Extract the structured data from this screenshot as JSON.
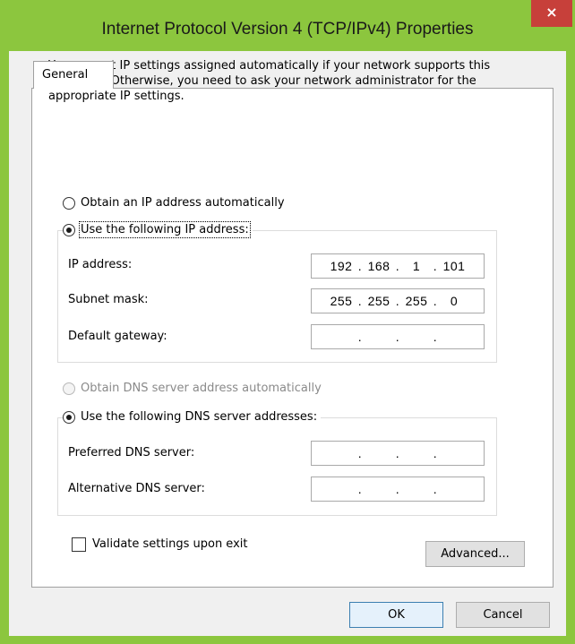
{
  "window": {
    "title": "Internet Protocol Version 4 (TCP/IPv4) Properties",
    "close_label": "×"
  },
  "tabs": [
    {
      "label": "General"
    }
  ],
  "general": {
    "description": "You can get IP settings assigned automatically if your network supports this capability. Otherwise, you need to ask your network administrator for the appropriate IP settings.",
    "ip_auto_label": "Obtain an IP address automatically",
    "ip_manual_label": "Use the following IP address:",
    "ip_mode": "manual",
    "fields": {
      "ip_address": {
        "label": "IP address:",
        "octets": [
          "192",
          "168",
          "1",
          "101"
        ]
      },
      "subnet_mask": {
        "label": "Subnet mask:",
        "octets": [
          "255",
          "255",
          "255",
          "0"
        ]
      },
      "default_gateway": {
        "label": "Default gateway:",
        "octets": [
          "",
          "",
          "",
          ""
        ]
      }
    },
    "dns_auto_label": "Obtain DNS server address automatically",
    "dns_auto_enabled": false,
    "dns_manual_label": "Use the following DNS server addresses:",
    "dns_mode": "manual",
    "dns_fields": {
      "preferred": {
        "label": "Preferred DNS server:",
        "octets": [
          "",
          "",
          "",
          ""
        ]
      },
      "alternative": {
        "label": "Alternative DNS server:",
        "octets": [
          "",
          "",
          "",
          ""
        ]
      }
    },
    "validate_label": "Validate settings upon exit",
    "validate_checked": false,
    "advanced_label": "Advanced..."
  },
  "footer": {
    "ok_label": "OK",
    "cancel_label": "Cancel"
  },
  "colors": {
    "frame": "#8cc63e",
    "close": "#c7403a",
    "client": "#f0f0f0"
  }
}
